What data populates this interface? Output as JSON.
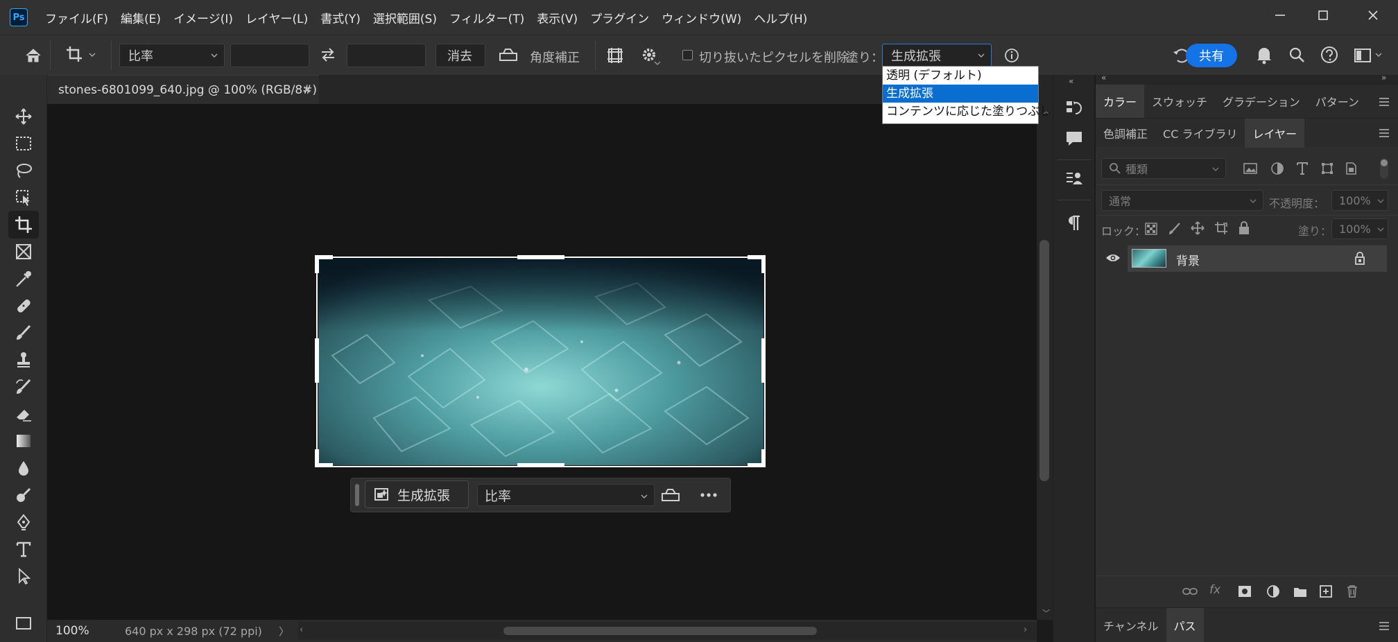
{
  "app": {
    "logo": "Ps"
  },
  "menu": [
    "ファイル(F)",
    "編集(E)",
    "イメージ(I)",
    "レイヤー(L)",
    "書式(Y)",
    "選択範囲(S)",
    "フィルター(T)",
    "表示(V)",
    "プラグイン",
    "ウィンドウ(W)",
    "ヘルプ(H)"
  ],
  "options": {
    "ratio": "比率",
    "clear": "消去",
    "straighten": "角度補正",
    "delete_cropped": "切り抜いたピクセルを削除",
    "fill_label": "塗り：",
    "fill_value": "生成拡張",
    "share": "共有"
  },
  "fill_dropdown": {
    "options": [
      "透明 (デフォルト)",
      "生成拡張",
      "コンテンツに応じた塗りつぶし"
    ],
    "selected_index": 1
  },
  "document": {
    "tab_title": "stones-6801099_640.jpg @ 100% (RGB/8#)",
    "zoom": "100%",
    "info": "640 px x 298 px (72 ppi)"
  },
  "context_bar": {
    "generative_expand": "生成拡張",
    "ratio": "比率"
  },
  "panels": {
    "top_tabs": [
      "カラー",
      "スウォッチ",
      "グラデーション",
      "パターン"
    ],
    "mid_tabs": [
      "色調補正",
      "CC ライブラリ",
      "レイヤー"
    ],
    "active_mid_tab": "レイヤー",
    "search_placeholder": "種類",
    "blend_mode": "通常",
    "opacity_label": "不透明度：",
    "opacity_value": "100%",
    "lock_label": "ロック：",
    "fill_label": "塗り：",
    "fill_value": "100%",
    "layers": [
      {
        "name": "背景",
        "visible": true,
        "locked": true
      }
    ],
    "bottom_tabs": [
      "チャンネル",
      "パス"
    ]
  },
  "colors": {
    "accent": "#1473e6",
    "selection": "#0a6ed1"
  }
}
